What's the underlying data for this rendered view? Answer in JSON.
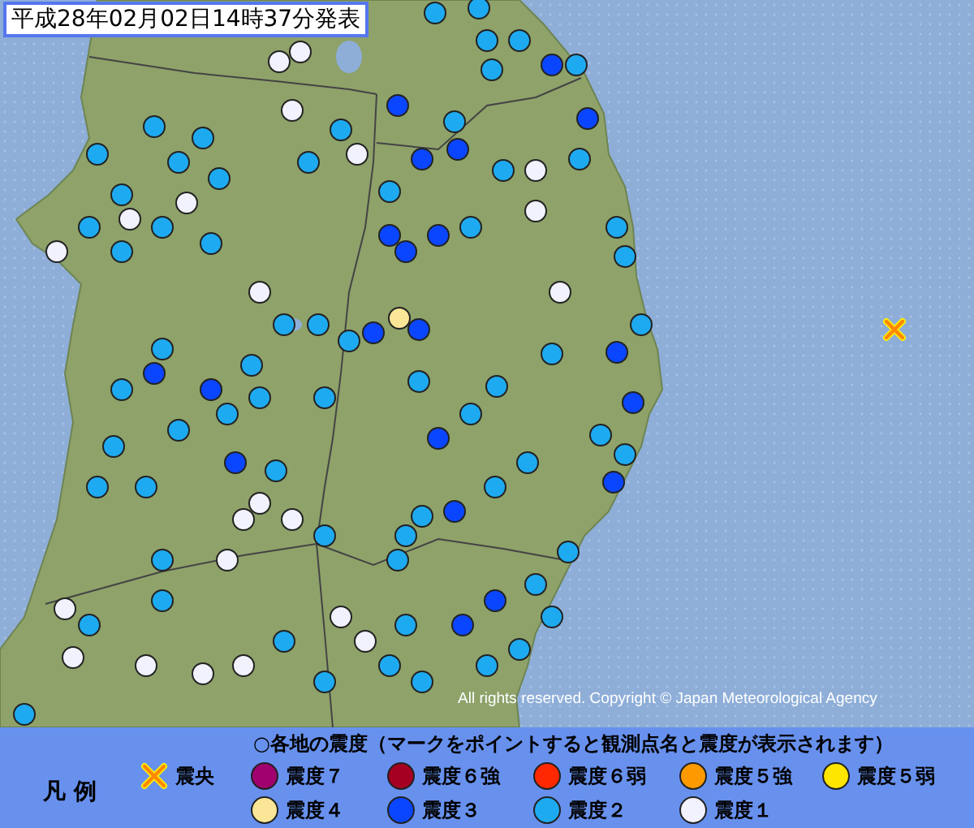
{
  "title": "平成28年02月02日14時37分発表",
  "copyright": "All rights reserved. Copyright © Japan Meteorological Agency",
  "stations": [
    {
      "color": "#1eaaf0"
    },
    {
      "color": "#1eaaf0"
    },
    {
      "color": "#1eaaf0"
    },
    {
      "color": "#1eaaf0"
    },
    {
      "color": "#1eaaf0"
    },
    {
      "color": "#0a46ff"
    },
    {
      "color": "#1eaaf0"
    },
    {
      "color": "#f2f2ff"
    },
    {
      "color": "#f2f2ff"
    },
    {
      "color": "#f2f2ff"
    },
    {
      "color": "#0a46ff"
    },
    {
      "color": "#0a46ff"
    },
    {
      "color": "#1eaaf0"
    },
    {
      "color": "#0a46ff"
    },
    {
      "color": "#1eaaf0"
    },
    {
      "color": "#f2f2ff"
    },
    {
      "color": "#1eaaf0"
    },
    {
      "color": "#0a46ff"
    },
    {
      "color": "#1eaaf0"
    },
    {
      "color": "#1eaaf0"
    },
    {
      "color": "#f2f2ff"
    },
    {
      "color": "#1eaaf0"
    },
    {
      "color": "#1eaaf0"
    },
    {
      "color": "#0a46ff"
    },
    {
      "color": "#0a46ff"
    },
    {
      "color": "#0a46ff"
    },
    {
      "color": "#1eaaf0"
    },
    {
      "color": "#f2f2ff"
    },
    {
      "color": "#f2f2ff"
    },
    {
      "color": "#1eaaf0"
    },
    {
      "color": "#1eaaf0"
    },
    {
      "color": "#0a46ff"
    },
    {
      "color": "#1eaaf0"
    },
    {
      "color": "#1eaaf0"
    },
    {
      "color": "#0a46ff"
    },
    {
      "color": "#0a46ff"
    },
    {
      "color": "#fae696"
    },
    {
      "color": "#1eaaf0"
    },
    {
      "color": "#1eaaf0"
    },
    {
      "color": "#1eaaf0"
    },
    {
      "color": "#0a46ff"
    },
    {
      "color": "#1eaaf0"
    },
    {
      "color": "#1eaaf0"
    },
    {
      "color": "#0a46ff"
    },
    {
      "color": "#1eaaf0"
    },
    {
      "color": "#0a46ff"
    },
    {
      "color": "#1eaaf0"
    },
    {
      "color": "#1eaaf0"
    },
    {
      "color": "#1eaaf0"
    },
    {
      "color": "#1eaaf0"
    },
    {
      "color": "#0a46ff"
    },
    {
      "color": "#1eaaf0"
    },
    {
      "color": "#1eaaf0"
    },
    {
      "color": "#1eaaf0"
    },
    {
      "color": "#0a46ff"
    },
    {
      "color": "#0a46ff"
    },
    {
      "color": "#1eaaf0"
    },
    {
      "color": "#1eaaf0"
    },
    {
      "color": "#f2f2ff"
    },
    {
      "color": "#1eaaf0"
    },
    {
      "color": "#1eaaf0"
    },
    {
      "color": "#1eaaf0"
    },
    {
      "color": "#1eaaf0"
    },
    {
      "color": "#1eaaf0"
    },
    {
      "color": "#1eaaf0"
    },
    {
      "color": "#1eaaf0"
    },
    {
      "color": "#1eaaf0"
    },
    {
      "color": "#1eaaf0"
    },
    {
      "color": "#1eaaf0"
    },
    {
      "color": "#f2f2ff"
    },
    {
      "color": "#f2f2ff"
    },
    {
      "color": "#1eaaf0"
    },
    {
      "color": "#f2f2ff"
    },
    {
      "color": "#1eaaf0"
    },
    {
      "color": "#1eaaf0"
    },
    {
      "color": "#1eaaf0"
    },
    {
      "color": "#1eaaf0"
    },
    {
      "color": "#f2f2ff"
    },
    {
      "color": "#1eaaf0"
    },
    {
      "color": "#1eaaf0"
    },
    {
      "color": "#1eaaf0"
    },
    {
      "color": "#0a46ff"
    },
    {
      "color": "#0a46ff"
    },
    {
      "color": "#1eaaf0"
    },
    {
      "color": "#1eaaf0"
    },
    {
      "color": "#1eaaf0"
    },
    {
      "color": "#1eaaf0"
    },
    {
      "color": "#1eaaf0"
    },
    {
      "color": "#1eaaf0"
    },
    {
      "color": "#0a46ff"
    },
    {
      "color": "#1eaaf0"
    },
    {
      "color": "#f2f2ff"
    },
    {
      "color": "#f2f2ff"
    },
    {
      "color": "#f2f2ff"
    },
    {
      "color": "#1eaaf0"
    },
    {
      "color": "#1eaaf0"
    },
    {
      "color": "#f2f2ff"
    },
    {
      "color": "#1eaaf0"
    },
    {
      "color": "#1eaaf0"
    },
    {
      "color": "#f2f2ff"
    },
    {
      "color": "#1eaaf0"
    },
    {
      "color": "#1eaaf0"
    },
    {
      "color": "#f2f2ff"
    },
    {
      "color": "#f2f2ff"
    },
    {
      "color": "#f2f2ff"
    },
    {
      "color": "#f2f2ff"
    },
    {
      "color": "#1eaaf0"
    },
    {
      "color": "#1eaaf0"
    },
    {
      "color": "#f2f2ff"
    }
  ],
  "legend": {
    "label": "凡 例",
    "heading": "○各地の震度（マークをポイントすると観測点名と震度が表示されます）",
    "items": [
      {
        "kind": "epicenter",
        "label": "震央"
      },
      {
        "kind": "intensity",
        "label": "震度７",
        "color": "#a0006e"
      },
      {
        "kind": "intensity",
        "label": "震度６強",
        "color": "#a50021"
      },
      {
        "kind": "intensity",
        "label": "震度６弱",
        "color": "#ff2800"
      },
      {
        "kind": "intensity",
        "label": "震度５強",
        "color": "#ff9900"
      },
      {
        "kind": "intensity",
        "label": "震度５弱",
        "color": "#ffe600"
      },
      {
        "kind": "intensity",
        "label": "震度４",
        "color": "#fae696"
      },
      {
        "kind": "intensity",
        "label": "震度３",
        "color": "#0a46ff"
      },
      {
        "kind": "intensity",
        "label": "震度２",
        "color": "#1eaaf0"
      },
      {
        "kind": "intensity",
        "label": "震度１",
        "color": "#f2f2ff"
      }
    ]
  }
}
